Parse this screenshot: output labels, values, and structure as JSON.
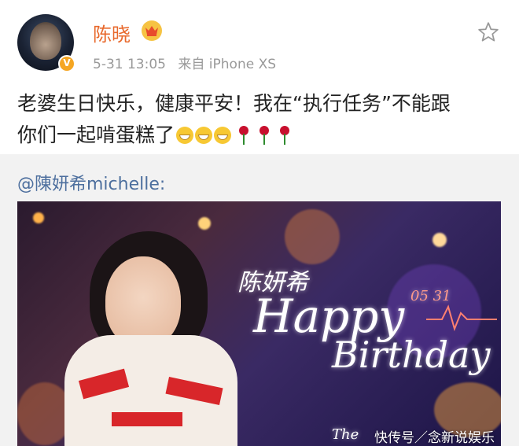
{
  "post": {
    "username": "陈晓",
    "time": "5-31 13:05",
    "source": "来自 iPhone XS",
    "content_line1": "老婆生日快乐，健康平安！我在“执行任务”不能跟",
    "content_line2": "你们一起啃蛋糕了"
  },
  "repost": {
    "mention": "@陳妍希michelle:",
    "image_texts": {
      "name": "陈妍希",
      "date": "05 31",
      "happy": "Happy",
      "birthday": "Birthday",
      "footer": "The"
    }
  },
  "watermark": "快传号／念新说娱乐",
  "colors": {
    "username": "#e8692c",
    "mention": "#4d6f9e",
    "meta": "#999999"
  },
  "icons": [
    "avatar",
    "verified-badge-icon",
    "crown-icon",
    "star-icon",
    "grin-emoji-icon",
    "rose-icon"
  ]
}
